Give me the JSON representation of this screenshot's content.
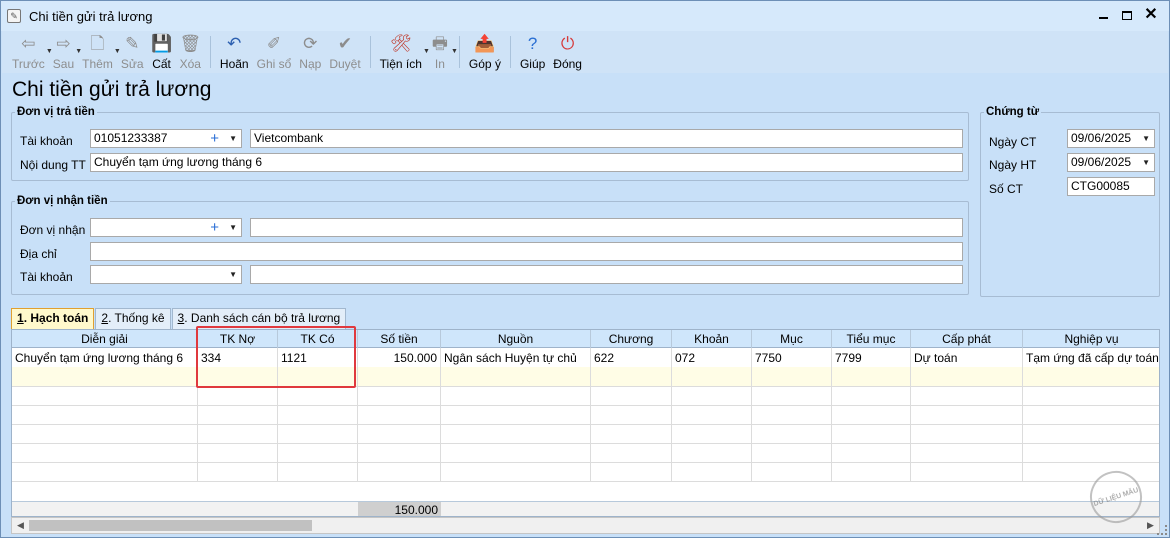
{
  "window": {
    "title": "Chi tiền gửi trả lương"
  },
  "toolbar": [
    {
      "name": "back",
      "label": "Trước",
      "icon": "⇦",
      "enabled": false,
      "dropdown": true
    },
    {
      "name": "next",
      "label": "Sau",
      "icon": "⇨",
      "enabled": false,
      "dropdown": true
    },
    {
      "name": "add",
      "label": "Thêm",
      "icon": "🗋",
      "enabled": false,
      "dropdown": true
    },
    {
      "name": "edit",
      "label": "Sửa",
      "icon": "✎",
      "enabled": false,
      "dropdown": false
    },
    {
      "name": "save",
      "label": "Cất",
      "icon": "💾",
      "enabled": true,
      "dropdown": false
    },
    {
      "name": "delete",
      "label": "Xóa",
      "icon": "🗑",
      "enabled": false,
      "dropdown": false
    },
    {
      "name": "undo",
      "label": "Hoãn",
      "icon": "↶",
      "enabled": true,
      "dropdown": false
    },
    {
      "name": "post",
      "label": "Ghi sổ",
      "icon": "✐",
      "enabled": false,
      "dropdown": false
    },
    {
      "name": "reload",
      "label": "Nạp",
      "icon": "⟳",
      "enabled": false,
      "dropdown": false
    },
    {
      "name": "approve",
      "label": "Duyệt",
      "icon": "✔",
      "enabled": false,
      "dropdown": false
    },
    {
      "name": "utilities",
      "label": "Tiện ích",
      "icon": "🛠",
      "enabled": true,
      "dropdown": true
    },
    {
      "name": "print",
      "label": "In",
      "icon": "🖶",
      "enabled": false,
      "dropdown": true
    },
    {
      "name": "feedback",
      "label": "Góp ý",
      "icon": "📤",
      "enabled": true,
      "dropdown": false
    },
    {
      "name": "help",
      "label": "Giúp",
      "icon": "?",
      "enabled": true,
      "dropdown": false
    },
    {
      "name": "close",
      "label": "Đóng",
      "icon": "⏻",
      "enabled": true,
      "dropdown": false
    }
  ],
  "colors": {
    "save": "#2b5fb0",
    "undo": "#2b5fb0",
    "utilities": "#c0392b",
    "feedback": "#d08a00",
    "help": "#2a6fd3",
    "close": "#d63a3a",
    "highlight": "#e0393e"
  },
  "page_title": "Chi tiền gửi trả lương",
  "payer": {
    "legend": "Đơn vị trả tiền",
    "account_label": "Tài khoản",
    "account_value": "01051233387",
    "bank_name": "Vietcombank",
    "content_label": "Nội dung TT",
    "content_value": "Chuyển tạm ứng lương tháng 6"
  },
  "payee": {
    "legend": "Đơn vị nhận tiền",
    "unit_label": "Đơn vị nhận",
    "unit_value": "",
    "unit_name": "",
    "address_label": "Địa chỉ",
    "address_value": "",
    "account_label": "Tài khoản",
    "account_value": "",
    "bank_name": ""
  },
  "voucher": {
    "legend": "Chứng từ",
    "date_ct_label": "Ngày CT",
    "date_ct_value": "09/06/2025",
    "date_ht_label": "Ngày HT",
    "date_ht_value": "09/06/2025",
    "number_label": "Số CT",
    "number_value": "CTG00085"
  },
  "tabs": [
    {
      "key": "1",
      "label": ". Hạch toán",
      "active": true
    },
    {
      "key": "2",
      "label": ". Thống kê",
      "active": false
    },
    {
      "key": "3",
      "label": ". Danh sách cán bộ trả lương",
      "active": false
    }
  ],
  "grid": {
    "columns": [
      "Diễn giải",
      "TK Nợ",
      "TK Có",
      "Số tiền",
      "Nguồn",
      "Chương",
      "Khoản",
      "Mục",
      "Tiểu mục",
      "Cấp phát",
      "Nghiệp vụ"
    ],
    "rows": [
      [
        "Chuyển tạm ứng lương tháng 6",
        "334",
        "1121",
        "150.000",
        "Ngân sách Huyện tự chủ",
        "622",
        "072",
        "7750",
        "7799",
        "Dự toán",
        "Tạm ứng đã cấp dự toán"
      ]
    ],
    "total": "150.000"
  },
  "stamp": {
    "text": "DỮ LIỆU MẪU"
  }
}
